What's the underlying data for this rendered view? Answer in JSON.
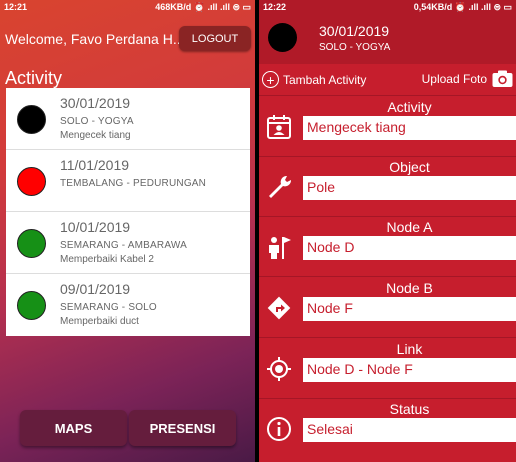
{
  "left": {
    "status": {
      "time": "12:21",
      "info": "468KB/d ⏰ .ıll .ıll ⊜ ▭"
    },
    "welcome": "Welcome, Favo Perdana H...",
    "logout_label": "LOGOUT",
    "section_title": "Activity",
    "activities": [
      {
        "date": "30/01/2019",
        "route": "SOLO - YOGYA",
        "desc": "Mengecek tiang",
        "color": "#000000"
      },
      {
        "date": "11/01/2019",
        "route": "TEMBALANG - PEDURUNGAN",
        "desc": "",
        "color": "#ff0000"
      },
      {
        "date": "10/01/2019",
        "route": "SEMARANG - AMBARAWA",
        "desc": "Memperbaiki Kabel 2",
        "color": "#169016"
      },
      {
        "date": "09/01/2019",
        "route": "SEMARANG - SOLO",
        "desc": "Memperbaiki duct",
        "color": "#169016"
      }
    ],
    "maps_label": "MAPS",
    "presensi_label": "PRESENSI"
  },
  "right": {
    "status": {
      "time": "12:22",
      "info": "0,54KB/d ⏰ .ıll .ıll ⊜ ▭"
    },
    "header": {
      "date": "30/01/2019",
      "route": "SOLO - YOGYA"
    },
    "tambah_label": "Tambah Activity",
    "upload_label": "Upload Foto",
    "fields": [
      {
        "label": "Activity",
        "value": "Mengecek tiang",
        "icon": "calendar-person-icon"
      },
      {
        "label": "Object",
        "value": "Pole",
        "icon": "wrench-icon"
      },
      {
        "label": "Node A",
        "value": "Node D",
        "icon": "person-flag-icon"
      },
      {
        "label": "Node B",
        "value": "Node F",
        "icon": "direction-sign-icon"
      },
      {
        "label": "Link",
        "value": "Node D - Node F",
        "icon": "location-target-icon"
      },
      {
        "label": "Status",
        "value": "Selesai",
        "icon": "info-icon"
      }
    ]
  }
}
